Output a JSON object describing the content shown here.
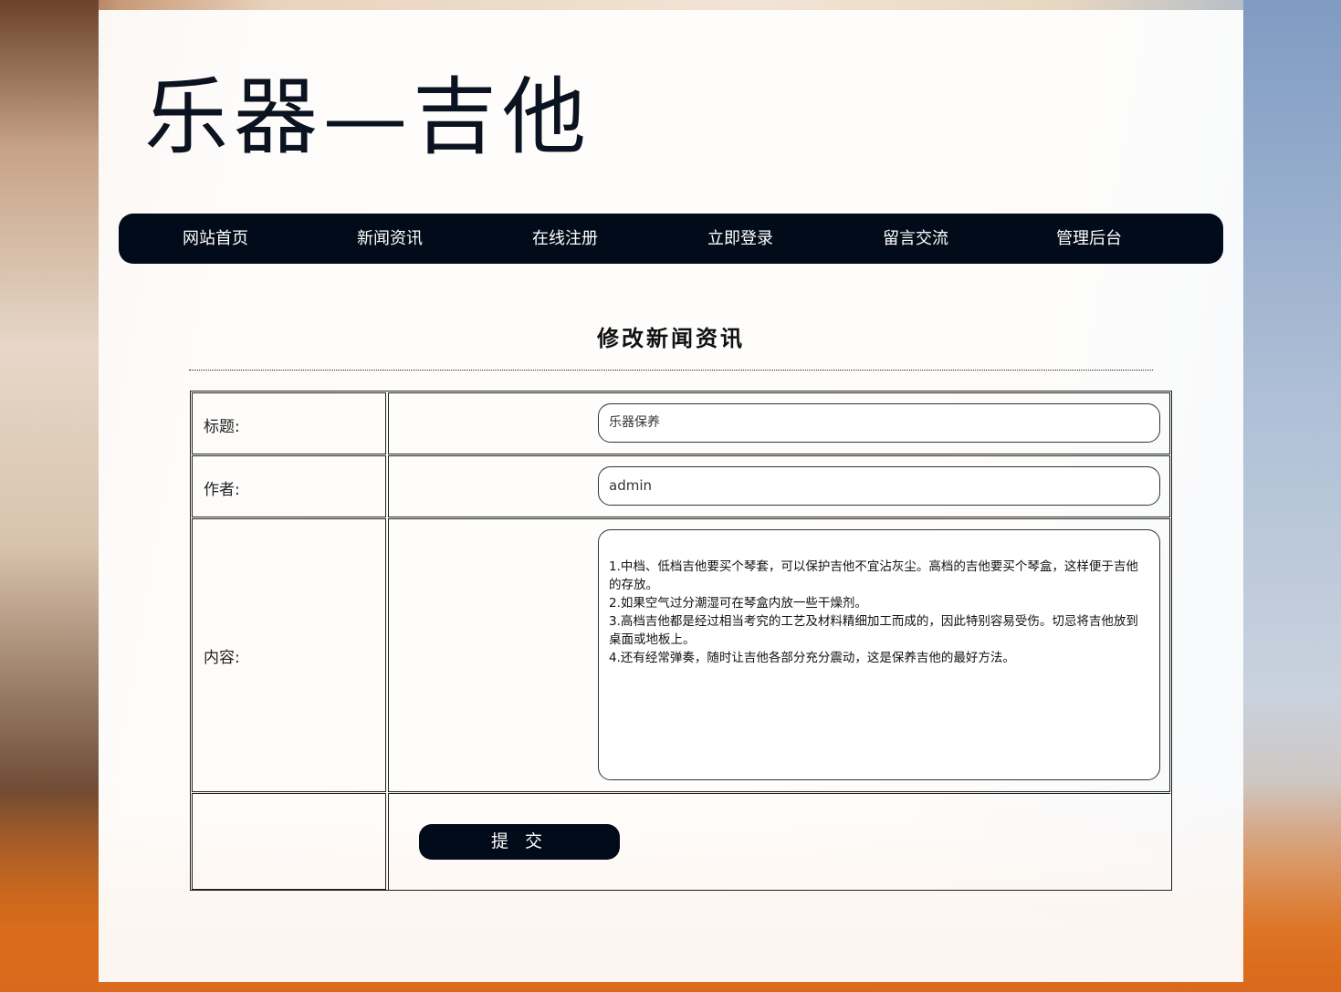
{
  "site": {
    "logo_text": "乐器—吉他"
  },
  "nav": {
    "items": [
      {
        "label": "网站首页"
      },
      {
        "label": "新闻资讯"
      },
      {
        "label": "在线注册"
      },
      {
        "label": "立即登录"
      },
      {
        "label": "留言交流"
      },
      {
        "label": "管理后台"
      }
    ]
  },
  "page": {
    "title": "修改新闻资讯"
  },
  "form": {
    "title_label": "标题:",
    "title_value": "乐器保养",
    "author_label": "作者:",
    "author_value": "admin",
    "content_label": "内容:",
    "content_value": "1.中档、低档吉他要买个琴套，可以保护吉他不宜沾灰尘。高档的吉他要买个琴盒，这样便于吉他的存放。\n2.如果空气过分潮湿可在琴盒内放一些干燥剂。\n3.高档吉他都是经过相当考究的工艺及材料精细加工而成的，因此特别容易受伤。切忌将吉他放到桌面或地板上。\n4.还有经常弹奏，随时让吉他各部分充分震动，这是保养吉他的最好方法。",
    "submit_label": "提 交"
  },
  "colors": {
    "nav_bg": "#020b19",
    "panel_bg": "#ffffff",
    "text": "#222222"
  }
}
